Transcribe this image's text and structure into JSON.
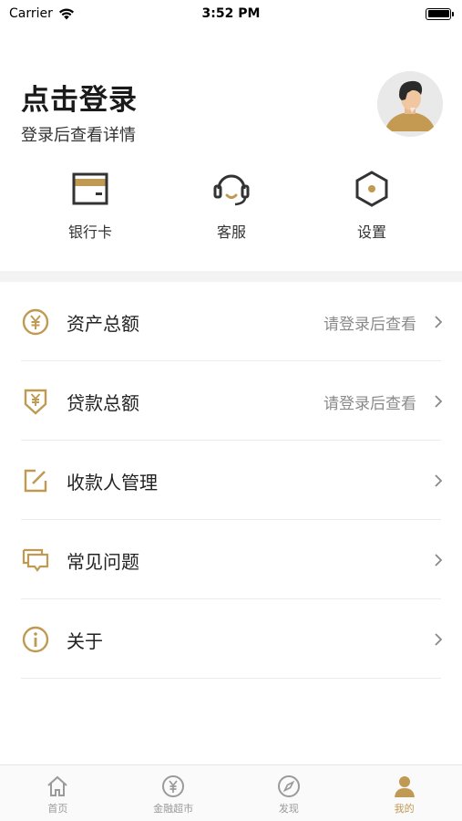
{
  "status_bar": {
    "carrier": "Carrier",
    "time": "3:52 PM"
  },
  "profile": {
    "title": "点击登录",
    "subtitle": "登录后查看详情"
  },
  "quick_actions": [
    {
      "label": "银行卡",
      "icon": "bank-card-icon"
    },
    {
      "label": "客服",
      "icon": "headset-icon"
    },
    {
      "label": "设置",
      "icon": "settings-hexagon-icon"
    }
  ],
  "menu": [
    {
      "label": "资产总额",
      "value": "请登录后查看",
      "icon": "yen-circle-icon"
    },
    {
      "label": "贷款总额",
      "value": "请登录后查看",
      "icon": "yen-shield-icon"
    },
    {
      "label": "收款人管理",
      "value": "",
      "icon": "edit-icon"
    },
    {
      "label": "常见问题",
      "value": "",
      "icon": "chat-bubbles-icon"
    },
    {
      "label": "关于",
      "value": "",
      "icon": "info-icon"
    }
  ],
  "tabbar": [
    {
      "label": "首页",
      "icon": "home-icon",
      "active": false
    },
    {
      "label": "金融超市",
      "icon": "yen-icon",
      "active": false
    },
    {
      "label": "发现",
      "icon": "compass-icon",
      "active": false
    },
    {
      "label": "我的",
      "icon": "person-icon",
      "active": true
    }
  ],
  "colors": {
    "accent": "#c09a52",
    "icon_dark": "#333333",
    "muted_text": "#8a8a8a"
  }
}
